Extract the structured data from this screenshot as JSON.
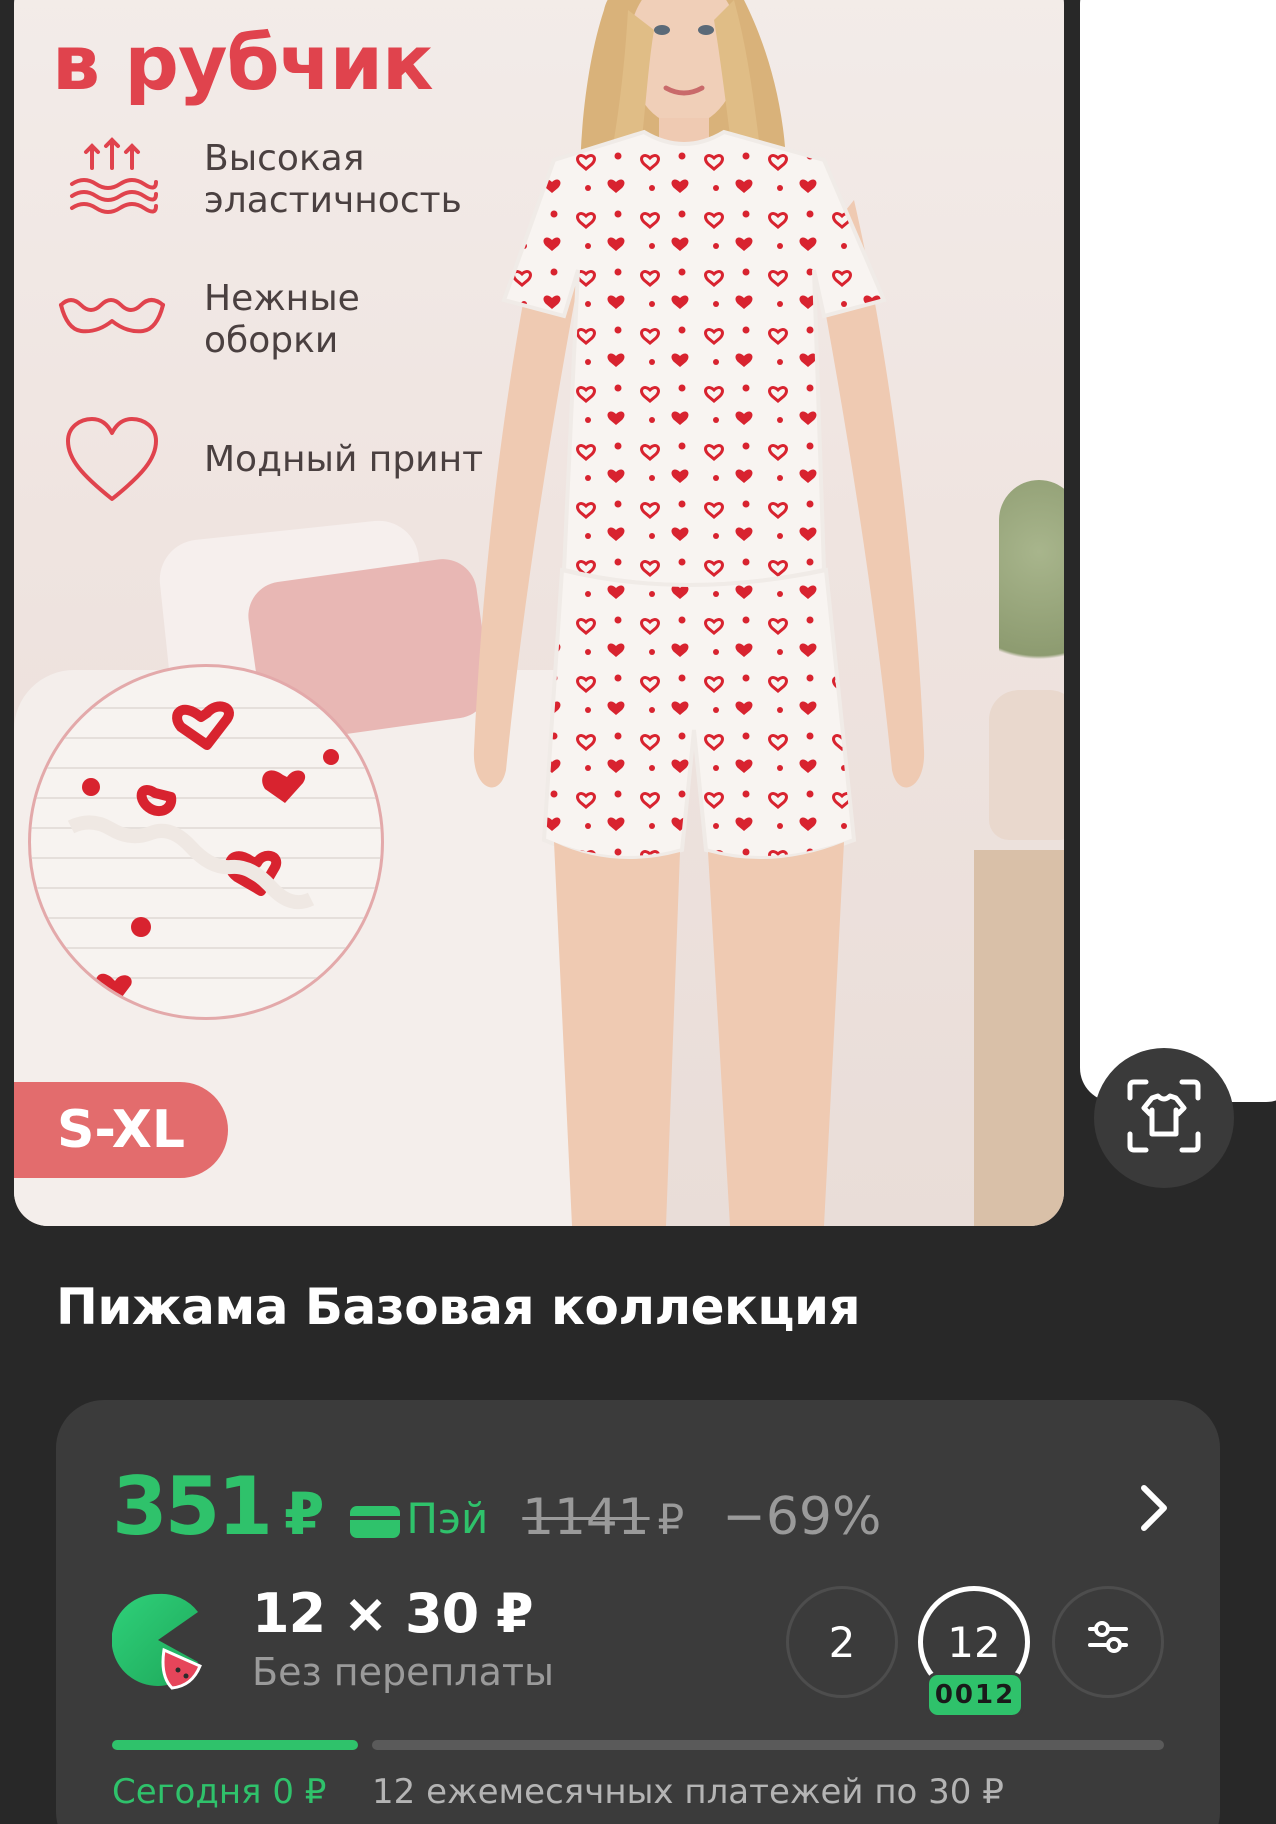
{
  "promo": {
    "title": "в рубчик",
    "features": [
      {
        "icon": "elasticity-icon",
        "label": "Высокая эластичность"
      },
      {
        "icon": "ruffle-icon",
        "label": "Нежные оборки"
      },
      {
        "icon": "heart-icon",
        "label": "Модный принт"
      }
    ],
    "size_range": "S-XL"
  },
  "scan_button": {
    "icon": "tshirt-scan-icon"
  },
  "product": {
    "title": "Пижама Базовая коллекция"
  },
  "price": {
    "current": "351",
    "currency": "₽",
    "pay_label": "Пэй",
    "old": "1141",
    "old_currency": "₽",
    "discount": "−69%"
  },
  "installment": {
    "amount": "12 × 30 ₽",
    "note": "Без переплаты",
    "options": [
      "2",
      "12"
    ],
    "selected": "12",
    "selected_tag": "0012",
    "today": "Сегодня 0 ₽",
    "monthly": "12 ежемесячных платежей по 30 ₽",
    "progress_today_fraction": 0.24
  },
  "colors": {
    "accent_green": "#2fc26b",
    "promo_red": "#e0434d",
    "background": "#282828",
    "card": "#3b3b3b"
  }
}
